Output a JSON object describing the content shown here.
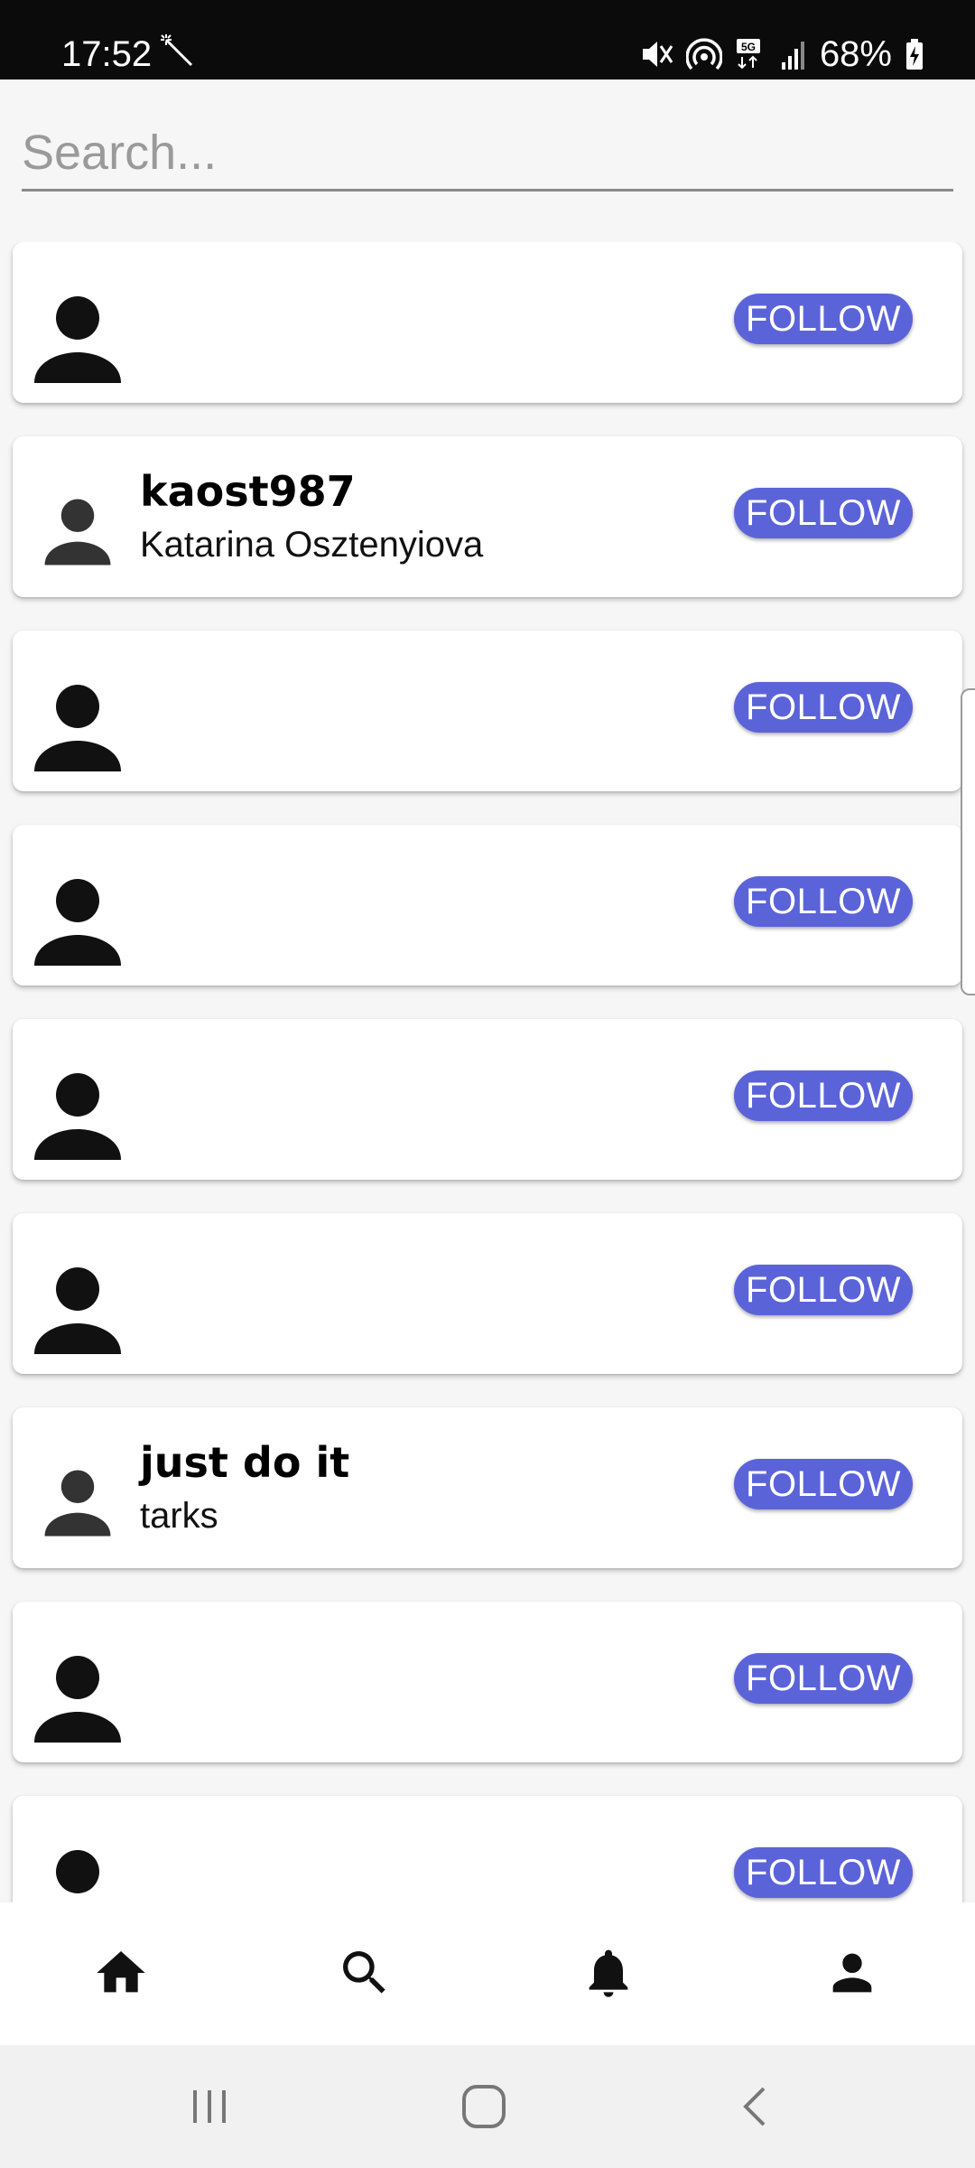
{
  "status_bar": {
    "time": "17:52",
    "battery": "68%"
  },
  "search": {
    "placeholder": "Search...",
    "value": ""
  },
  "users": [
    {
      "username": "",
      "name": "",
      "follow_label": "FOLLOW"
    },
    {
      "username": "kaost987",
      "name": "Katarina Osztenyiova",
      "follow_label": "FOLLOW"
    },
    {
      "username": "",
      "name": "",
      "follow_label": "FOLLOW"
    },
    {
      "username": "",
      "name": "",
      "follow_label": "FOLLOW"
    },
    {
      "username": "",
      "name": "",
      "follow_label": "FOLLOW"
    },
    {
      "username": "",
      "name": "",
      "follow_label": "FOLLOW"
    },
    {
      "username": "just do it",
      "name": "tarks",
      "follow_label": "FOLLOW"
    },
    {
      "username": "",
      "name": "",
      "follow_label": "FOLLOW"
    },
    {
      "username": "",
      "name": "",
      "follow_label": "FOLLOW"
    }
  ],
  "bottom_nav": {
    "items": [
      {
        "icon": "home-icon"
      },
      {
        "icon": "search-icon"
      },
      {
        "icon": "bell-icon"
      },
      {
        "icon": "person-icon"
      }
    ]
  },
  "system_nav": {
    "items": [
      "recents-icon",
      "home-circle-icon",
      "back-icon"
    ]
  },
  "colors": {
    "follow_button": "#5b63d9",
    "status_bar": "#0b0b0c",
    "avatar": "#111111"
  }
}
